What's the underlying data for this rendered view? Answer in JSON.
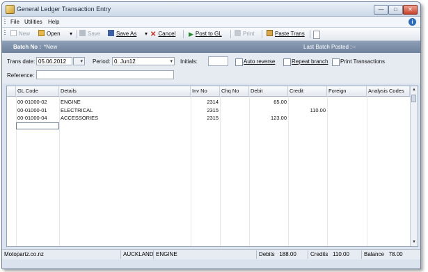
{
  "window": {
    "title": "General Ledger Transaction Entry"
  },
  "menu": [
    "File",
    "Utilities",
    "Help"
  ],
  "toolbar": {
    "new_label": "New",
    "open_label": "Open",
    "save_label": "Save",
    "save_as_label": "Save As",
    "cancel_label": "Cancel",
    "post_label": "Post to GL",
    "print_label": "Print",
    "paste_label": "Paste Trans"
  },
  "batch": {
    "label": "Batch No :",
    "value": "*New",
    "last_posted_label": "Last Batch Posted :",
    "last_posted_value": "--"
  },
  "form": {
    "trans_date_label": "Trans date:",
    "trans_date_value": "05.06.2012",
    "period_label": "Period:",
    "period_value": "0. Jun12",
    "initials_label": "Initials:",
    "initials_value": "",
    "auto_reverse_label": "Auto reverse",
    "repeat_branch_label": "Repeat branch",
    "print_transactions_label": "Print Transactions",
    "reference_label": "Reference:",
    "reference_value": ""
  },
  "grid": {
    "columns": [
      "GL Code",
      "Details",
      "Inv No",
      "Chq No",
      "Debit",
      "Credit",
      "Foreign",
      "Analysis Codes"
    ],
    "rows": [
      {
        "gl_code": "00-01000-02",
        "details": "ENGINE",
        "inv_no": "2314",
        "chq_no": "",
        "debit": "65.00",
        "credit": "",
        "foreign": "",
        "analysis": ""
      },
      {
        "gl_code": "00-01000-01",
        "details": "ELECTRICAL",
        "inv_no": "2315",
        "chq_no": "",
        "debit": "",
        "credit": "110.00",
        "foreign": "",
        "analysis": ""
      },
      {
        "gl_code": "00-01000-04",
        "details": "ACCESSORIES",
        "inv_no": "2315",
        "chq_no": "",
        "debit": "123.00",
        "credit": "",
        "foreign": "",
        "analysis": ""
      }
    ]
  },
  "status": {
    "company": "Motopartz.co.nz",
    "branch": "AUCKLAND",
    "account": "ENGINE",
    "debits_label": "Debits",
    "debits_value": "188.00",
    "credits_label": "Credits",
    "credits_value": "110.00",
    "balance_label": "Balance",
    "balance_value": "78.00"
  }
}
